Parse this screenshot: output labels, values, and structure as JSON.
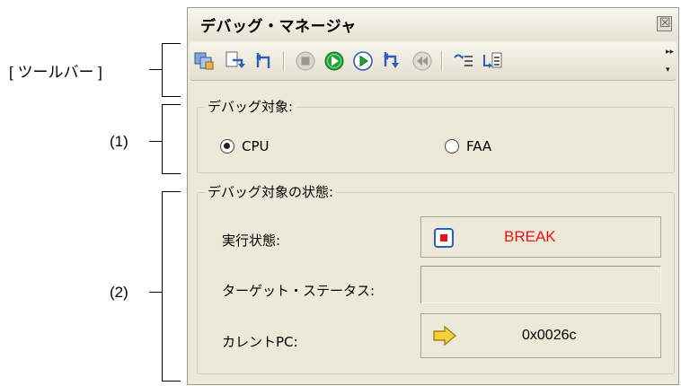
{
  "callouts": {
    "toolbar": "[ ツールバー ]",
    "area1": "(1)",
    "area2": "(2)"
  },
  "panel": {
    "title": "デバッグ・マネージャ",
    "close_icon": "close-icon"
  },
  "toolbar": {
    "buttons": [
      "view-icon",
      "step-in-icon",
      "return-icon",
      "stop-icon",
      "run-icon",
      "run-outline-icon",
      "step-over-icon",
      "rewind-icon",
      "list-in-icon",
      "list-out-icon"
    ]
  },
  "debug_target": {
    "label": "デバッグ対象:",
    "options": [
      "CPU",
      "FAA"
    ],
    "selected": "CPU"
  },
  "target_state": {
    "label": "デバッグ対象の状態:",
    "exec_state_label": "実行状態:",
    "exec_state_value": "BREAK",
    "target_status_label": "ターゲット・ステータス:",
    "target_status_value": "",
    "current_pc_label": "カレントPC:",
    "current_pc_value": "0x0026c"
  },
  "colors": {
    "break_text": "#e8141a",
    "panel_bg": "#ece9d8",
    "run_green": "#22a63a"
  }
}
